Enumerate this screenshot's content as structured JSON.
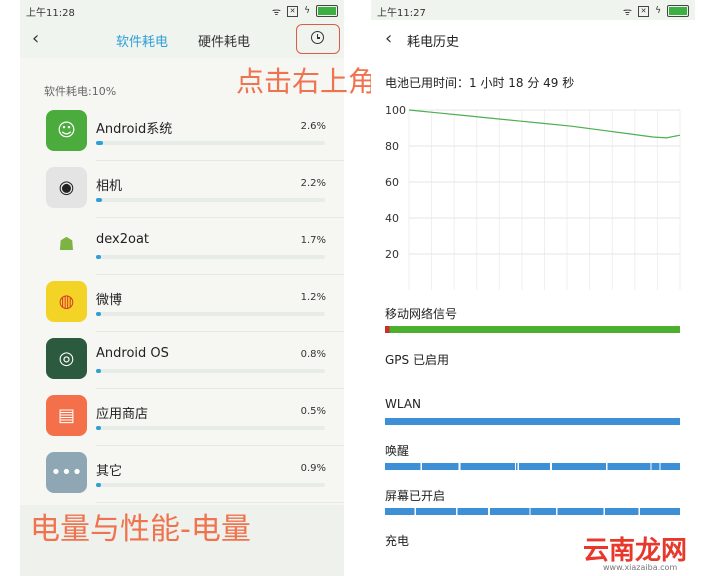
{
  "left": {
    "status_time": "上午11:28",
    "tabs": [
      "软件耗电",
      "硬件耗电"
    ],
    "annotation_top": "点击右上角",
    "section_label": "软件耗电:10%",
    "apps": [
      {
        "name": "Android系统",
        "pct": "2.6%",
        "level": 0.03,
        "color": "#4bab3d",
        "icon": "android-system-icon"
      },
      {
        "name": "相机",
        "pct": "2.2%",
        "level": 0.025,
        "color": "#e4e4e4",
        "icon": "camera-icon"
      },
      {
        "name": "dex2oat",
        "pct": "1.7%",
        "level": 0.02,
        "color": "#f6f7f3",
        "icon": "android-robot-icon"
      },
      {
        "name": "微博",
        "pct": "1.2%",
        "level": 0.015,
        "color": "#f3d426",
        "icon": "weibo-icon"
      },
      {
        "name": "Android OS",
        "pct": "0.8%",
        "level": 0.012,
        "color": "#2c5a3f",
        "icon": "android-os-icon"
      },
      {
        "name": "应用商店",
        "pct": "0.5%",
        "level": 0.01,
        "color": "#f4704a",
        "icon": "app-store-icon"
      },
      {
        "name": "其它",
        "pct": "0.9%",
        "level": 0.012,
        "color": "#8fa7b4",
        "icon": "more-icon"
      }
    ],
    "annotation_bottom": "电量与性能-电量",
    "accent": "#2f9fd8"
  },
  "right": {
    "status_time": "上午11:27",
    "title": "耗电历史",
    "usage_text": "电池已用时间：1 小时 18 分 49 秒",
    "chart_data": {
      "type": "line",
      "title": "",
      "xlabel": "",
      "ylabel": "",
      "ylim": [
        0,
        100
      ],
      "yticks": [
        100,
        80,
        60,
        40,
        20
      ],
      "x": [
        0,
        0.1,
        0.2,
        0.3,
        0.4,
        0.5,
        0.6,
        0.7,
        0.8,
        0.9,
        0.95,
        1.0
      ],
      "series": [
        {
          "values": [
            100,
            98.5,
            97,
            95.5,
            94,
            92.5,
            91,
            89,
            87,
            85,
            84.5,
            86
          ]
        }
      ],
      "line_color": "#4caf50",
      "grid": true
    },
    "tracks": [
      {
        "label": "移动网络信号",
        "color": "#4caf2e"
      },
      {
        "label": "GPS 已启用",
        "color": ""
      },
      {
        "label": "WLAN",
        "color": "#3d8fd6"
      },
      {
        "label": "唤醒",
        "color": "#3d8fd6"
      },
      {
        "label": "屏幕已开启",
        "color": "#3d8fd6"
      },
      {
        "label": "充电",
        "color": ""
      }
    ]
  },
  "watermark": {
    "text": "云南龙网",
    "url": "www.xiazaiba.com"
  }
}
